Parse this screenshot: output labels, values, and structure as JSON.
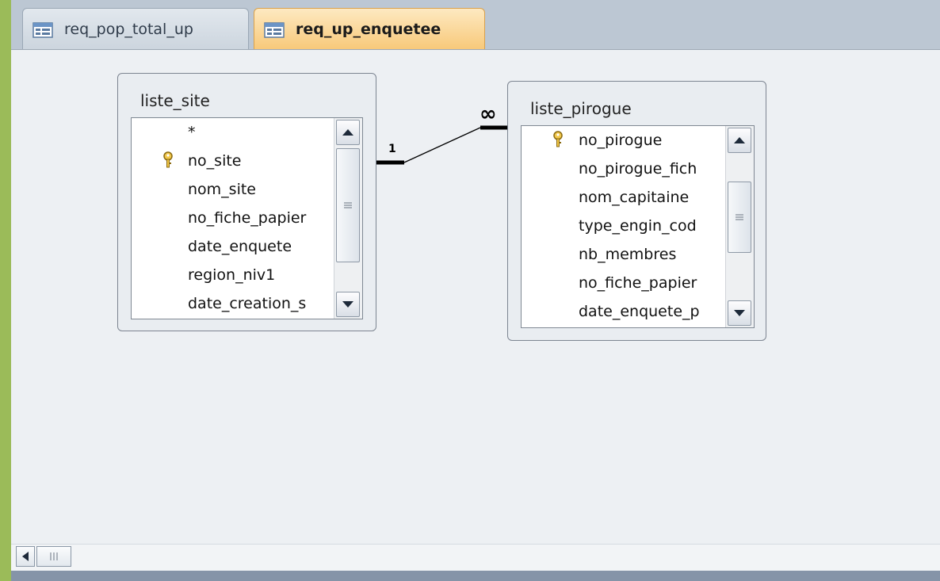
{
  "tabs": [
    {
      "label": "req_pop_total_up",
      "active": false,
      "icon": "query-icon"
    },
    {
      "label": "req_up_enquetee",
      "active": true,
      "icon": "query-icon"
    }
  ],
  "tables": {
    "liste_site": {
      "title": "liste_site",
      "fields": [
        {
          "label": "*",
          "key": false
        },
        {
          "label": "no_site",
          "key": true
        },
        {
          "label": "nom_site",
          "key": false
        },
        {
          "label": "no_fiche_papier",
          "key": false
        },
        {
          "label": "date_enquete",
          "key": false
        },
        {
          "label": "region_niv1",
          "key": false
        },
        {
          "label": "date_creation_s",
          "key": false
        }
      ]
    },
    "liste_pirogue": {
      "title": "liste_pirogue",
      "fields": [
        {
          "label": "no_pirogue",
          "key": true
        },
        {
          "label": "no_pirogue_fich",
          "key": false
        },
        {
          "label": "nom_capitaine",
          "key": false
        },
        {
          "label": "type_engin_cod",
          "key": false
        },
        {
          "label": "nb_membres",
          "key": false
        },
        {
          "label": "no_fiche_papier",
          "key": false
        },
        {
          "label": "date_enquete_p",
          "key": false
        }
      ]
    }
  },
  "relationship": {
    "one_label": "1",
    "many_label": "∞"
  },
  "colors": {
    "frame": "#9bbb59",
    "active_tab": "#f8c97a",
    "canvas": "#edf0f3"
  }
}
